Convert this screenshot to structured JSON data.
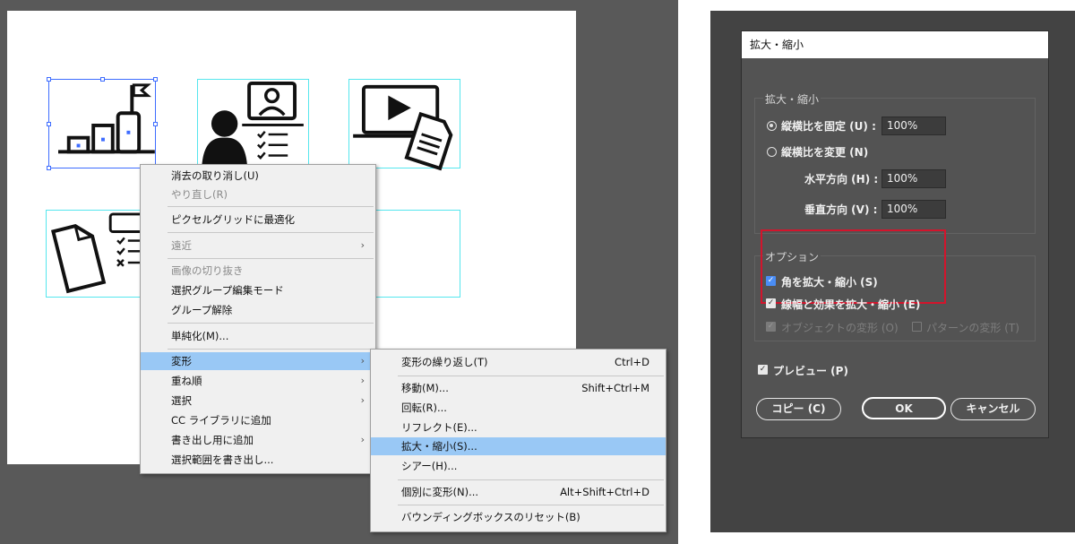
{
  "context_menu": {
    "items": [
      {
        "label": "消去の取り消し(U)",
        "disabled": false
      },
      {
        "label": "やり直し(R)",
        "disabled": true
      },
      {
        "label": "ピクセルグリッドに最適化",
        "disabled": false
      },
      {
        "label": "遠近",
        "disabled": true
      },
      {
        "label": "画像の切り抜き",
        "disabled": true
      },
      {
        "label": "選択グループ編集モード",
        "disabled": false
      },
      {
        "label": "グループ解除",
        "disabled": false
      },
      {
        "label": "単純化(M)...",
        "disabled": false
      },
      {
        "label": "変形",
        "disabled": false
      },
      {
        "label": "重ね順",
        "disabled": false
      },
      {
        "label": "選択",
        "disabled": false
      },
      {
        "label": "CC ライブラリに追加",
        "disabled": false
      },
      {
        "label": "書き出し用に追加",
        "disabled": false
      },
      {
        "label": "選択範囲を書き出し...",
        "disabled": false
      }
    ],
    "submenu_arrow": "›"
  },
  "transform_submenu": {
    "items": [
      {
        "label": "変形の繰り返し(T)",
        "shortcut": "Ctrl+D"
      },
      {
        "label": "移動(M)...",
        "shortcut": "Shift+Ctrl+M"
      },
      {
        "label": "回転(R)...",
        "shortcut": ""
      },
      {
        "label": "リフレクト(E)...",
        "shortcut": ""
      },
      {
        "label": "拡大・縮小(S)...",
        "shortcut": ""
      },
      {
        "label": "シアー(H)...",
        "shortcut": ""
      },
      {
        "label": "個別に変形(N)...",
        "shortcut": "Alt+Shift+Ctrl+D"
      },
      {
        "label": "バウンディングボックスのリセット(B)",
        "shortcut": ""
      }
    ]
  },
  "dialog": {
    "title": "拡大・縮小",
    "scale_group": {
      "title": "拡大・縮小",
      "uniform_label": "縦横比を固定 (U) :",
      "uniform_value": "100%",
      "nonuniform_label": "縦横比を変更 (N)",
      "horizontal_label": "水平方向 (H) :",
      "horizontal_value": "100%",
      "vertical_label": "垂直方向 (V) :",
      "vertical_value": "100%"
    },
    "options_group": {
      "title": "オプション",
      "scale_corners_label": "角を拡大・縮小 (S)",
      "scale_strokes_label": "線幅と効果を拡大・縮小 (E)",
      "transform_objects_label": "オブジェクトの変形 (O)",
      "transform_patterns_label": "パターンの変形 (T)"
    },
    "preview_label": "プレビュー (P)",
    "buttons": {
      "copy": "コピー (C)",
      "ok": "OK",
      "cancel": "キャンセル"
    },
    "check_glyph": "✓"
  },
  "colors": {
    "selection": "#3d6cff",
    "guide": "#55e6ee",
    "menu_highlight": "#99c8f5",
    "checkbox_blue": "#4a8df5",
    "highlight_box": "#d3142c"
  }
}
